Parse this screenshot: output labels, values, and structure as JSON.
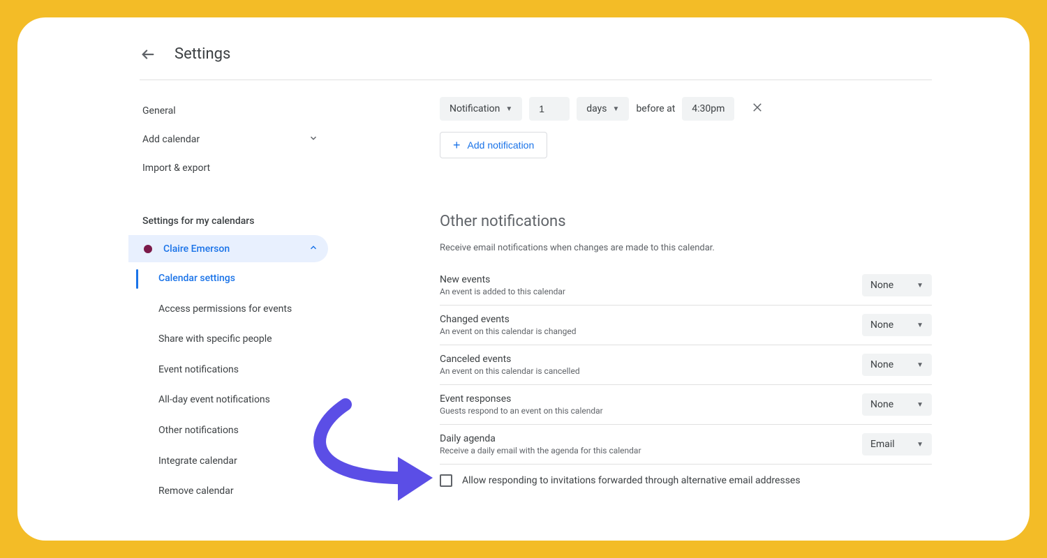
{
  "header": {
    "title": "Settings"
  },
  "sidebar": {
    "general": "General",
    "add_calendar": "Add calendar",
    "import_export": "Import & export",
    "section_title": "Settings for my calendars",
    "calendar_name": "Claire Emerson",
    "sub_items": {
      "calendar_settings": "Calendar settings",
      "access_permissions": "Access permissions for events",
      "share": "Share with specific people",
      "event_notifications": "Event notifications",
      "allday_notifications": "All-day event notifications",
      "other_notifications": "Other notifications",
      "integrate": "Integrate calendar",
      "remove": "Remove calendar"
    }
  },
  "notif_row": {
    "method": "Notification",
    "amount": "1",
    "unit": "days",
    "before_at": "before at",
    "time": "4:30pm"
  },
  "add_notification_label": "Add notification",
  "other_section": {
    "title": "Other notifications",
    "desc": "Receive email notifications when changes are made to this calendar.",
    "rows": [
      {
        "label": "New events",
        "desc": "An event is added to this calendar",
        "value": "None"
      },
      {
        "label": "Changed events",
        "desc": "An event on this calendar is changed",
        "value": "None"
      },
      {
        "label": "Canceled events",
        "desc": "An event on this calendar is cancelled",
        "value": "None"
      },
      {
        "label": "Event responses",
        "desc": "Guests respond to an event on this calendar",
        "value": "None"
      },
      {
        "label": "Daily agenda",
        "desc": "Receive a daily email with the agenda for this calendar",
        "value": "Email"
      }
    ],
    "checkbox_label": "Allow responding to invitations forwarded through alternative email addresses"
  }
}
